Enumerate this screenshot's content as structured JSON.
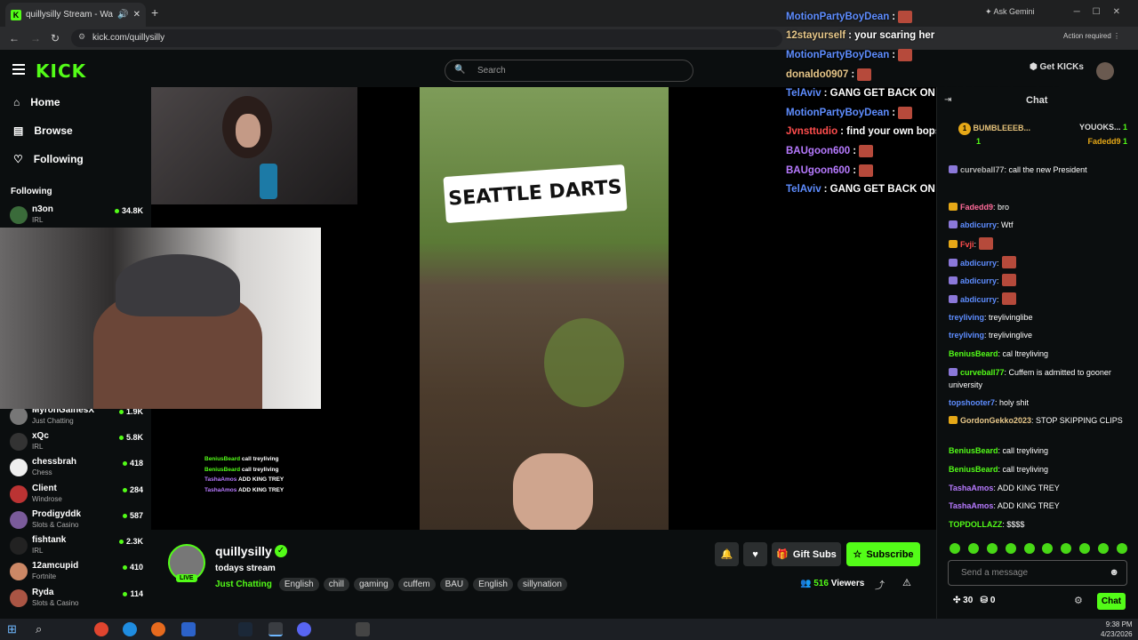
{
  "browser": {
    "tab_title": "quillysilly Stream - Watch Li",
    "url": "kick.com/quillysilly",
    "ask_label": "Ask Gemini",
    "action_required": "Action required"
  },
  "header": {
    "logo": "KICK",
    "search_placeholder": "Search",
    "get_kicks": "Get KICKs"
  },
  "sidebar": {
    "nav": [
      {
        "label": "Home",
        "icon": "home-icon"
      },
      {
        "label": "Browse",
        "icon": "browse-icon"
      },
      {
        "label": "Following",
        "icon": "heart-icon"
      }
    ],
    "following_title": "Following",
    "channels": [
      {
        "name": "n3on",
        "category": "IRL",
        "viewers": "34.8K"
      },
      {
        "name": "MyronGainesX",
        "category": "Just Chatting",
        "viewers": "1.9K"
      },
      {
        "name": "xQc",
        "category": "IRL",
        "viewers": "5.8K"
      },
      {
        "name": "chessbrah",
        "category": "Chess",
        "viewers": "418"
      },
      {
        "name": "Client",
        "category": "Windrose",
        "viewers": "284"
      },
      {
        "name": "Prodigyddk",
        "category": "Slots & Casino",
        "viewers": "587"
      },
      {
        "name": "fishtank",
        "category": "IRL",
        "viewers": "2.3K"
      },
      {
        "name": "12amcupid",
        "category": "Fortnite",
        "viewers": "410"
      },
      {
        "name": "Ryda",
        "category": "Slots & Casino",
        "viewers": "114"
      }
    ]
  },
  "video": {
    "caption": "SEATTLE DARTS",
    "overlay_chat": [
      {
        "user": "MotionPartyBoyDean",
        "text": " :",
        "color": "#5e8dff",
        "emote": true
      },
      {
        "user": "12stayurself",
        "text": " : your scaring her",
        "color": "#e8c88a",
        "emote": false
      },
      {
        "user": "MotionPartyBoyDean",
        "text": " :",
        "color": "#5e8dff",
        "emote": true
      },
      {
        "user": "donaldo0907",
        "text": " :",
        "color": "#e8c88a",
        "emote": true
      },
      {
        "user": "TelAviv",
        "text": " : GANG GET BACK ON CALLS THIS IS THIS PILL",
        "color": "#5e8dff",
        "emote": false
      },
      {
        "user": "MotionPartyBoyDean",
        "text": " :",
        "color": "#5e8dff",
        "emote": true
      },
      {
        "user": "Jvnsttudio",
        "text": " : find your own bops",
        "color": "#ff4d4d",
        "emote": false
      },
      {
        "user": "BAUgoon600",
        "text": " :",
        "color": "#b77aff",
        "emote": true
      },
      {
        "user": "BAUgoon600",
        "text": " :",
        "color": "#b77aff",
        "emote": true
      },
      {
        "user": "TelAviv",
        "text": " : GANG GET BACK ON CALLS THIS IS THIS PILL",
        "color": "#5e8dff",
        "emote": false
      }
    ],
    "mini_chat": [
      {
        "user": "BeniusBeard",
        "text": " call treyliving",
        "color": "#53fc18"
      },
      {
        "user": "BeniusBeard",
        "text": " call treyliving",
        "color": "#53fc18"
      },
      {
        "user": "TashaAmos",
        "text": " ADD KING TREY",
        "color": "#b77aff"
      },
      {
        "user": "TashaAmos",
        "text": " ADD KING TREY",
        "color": "#b77aff"
      }
    ]
  },
  "stream": {
    "name": "quillysilly",
    "live": "LIVE",
    "title": "todays stream",
    "category": "Just Chatting",
    "tags": [
      "English",
      "chill",
      "gaming",
      "cuffem",
      "BAU",
      "English",
      "sillynation"
    ],
    "gift_label": "Gift Subs",
    "subscribe_label": "Subscribe",
    "viewers": "516",
    "viewers_label": "Viewers"
  },
  "chat": {
    "title": "Chat",
    "leaders": [
      {
        "rank": "1",
        "name": "BUMBLEEEB...",
        "count": "1"
      },
      {
        "name": "YOUOKS...",
        "count": "1"
      },
      {
        "name": "Fadedd9",
        "count": "1"
      }
    ],
    "messages": [
      {
        "user": "curveball77",
        "text": ": call the new President",
        "color": "#b5b5b5",
        "badge": "#8b78d9"
      },
      {
        "user": "Fadedd9",
        "text": ": bro",
        "color": "#ff6b9a",
        "badge": "#e6a817"
      },
      {
        "user": "abdicurry",
        "text": ": Wtf",
        "color": "#5e8dff",
        "badge": "#8b78d9"
      },
      {
        "user": "Fvji",
        "text": ":",
        "color": "#ff4d4d",
        "badge": "#e6a817",
        "emote": true
      },
      {
        "user": "abdicurry",
        "text": ":",
        "color": "#5e8dff",
        "badge": "#8b78d9",
        "emote": true
      },
      {
        "user": "abdicurry",
        "text": ":",
        "color": "#5e8dff",
        "badge": "#8b78d9",
        "emote": true
      },
      {
        "user": "abdicurry",
        "text": ":",
        "color": "#5e8dff",
        "badge": "#8b78d9",
        "emote": true
      },
      {
        "user": "treyliving",
        "text": ": treylivinglibe",
        "color": "#5e8dff",
        "badge": ""
      },
      {
        "user": "treyliving",
        "text": ": treylivinglive",
        "color": "#5e8dff",
        "badge": ""
      },
      {
        "user": "BeniusBeard",
        "text": ": cal ltreyliving",
        "color": "#53fc18",
        "badge": ""
      },
      {
        "user": "curveball77",
        "text": ": Cuffem is admitted to gooner university",
        "color": "#53fc18",
        "badge": "#8b78d9"
      },
      {
        "user": "topshooter7",
        "text": ": holy shit",
        "color": "#5e8dff",
        "badge": ""
      },
      {
        "user": "GordonGekko2023",
        "text": ": STOP SKIPPING CLIPS",
        "color": "#e8c88a",
        "badge": "#e6a817"
      },
      {
        "user": "BeniusBeard",
        "text": ": call treyliving",
        "color": "#53fc18",
        "badge": ""
      },
      {
        "user": "BeniusBeard",
        "text": ": call treyliving",
        "color": "#53fc18",
        "badge": ""
      },
      {
        "user": "TashaAmos",
        "text": ": ADD KING TREY",
        "color": "#b77aff",
        "badge": ""
      },
      {
        "user": "TashaAmos",
        "text": ": ADD KING TREY",
        "color": "#b77aff",
        "badge": ""
      },
      {
        "user": "TOPDOLLAZZ",
        "text": ": $$$$",
        "color": "#53fc18",
        "badge": ""
      }
    ],
    "input_placeholder": "Send a message",
    "points": "30",
    "other_count": "0",
    "send_label": "Chat"
  },
  "taskbar": {
    "time": "9:38 PM",
    "date": "4/23/2026"
  }
}
